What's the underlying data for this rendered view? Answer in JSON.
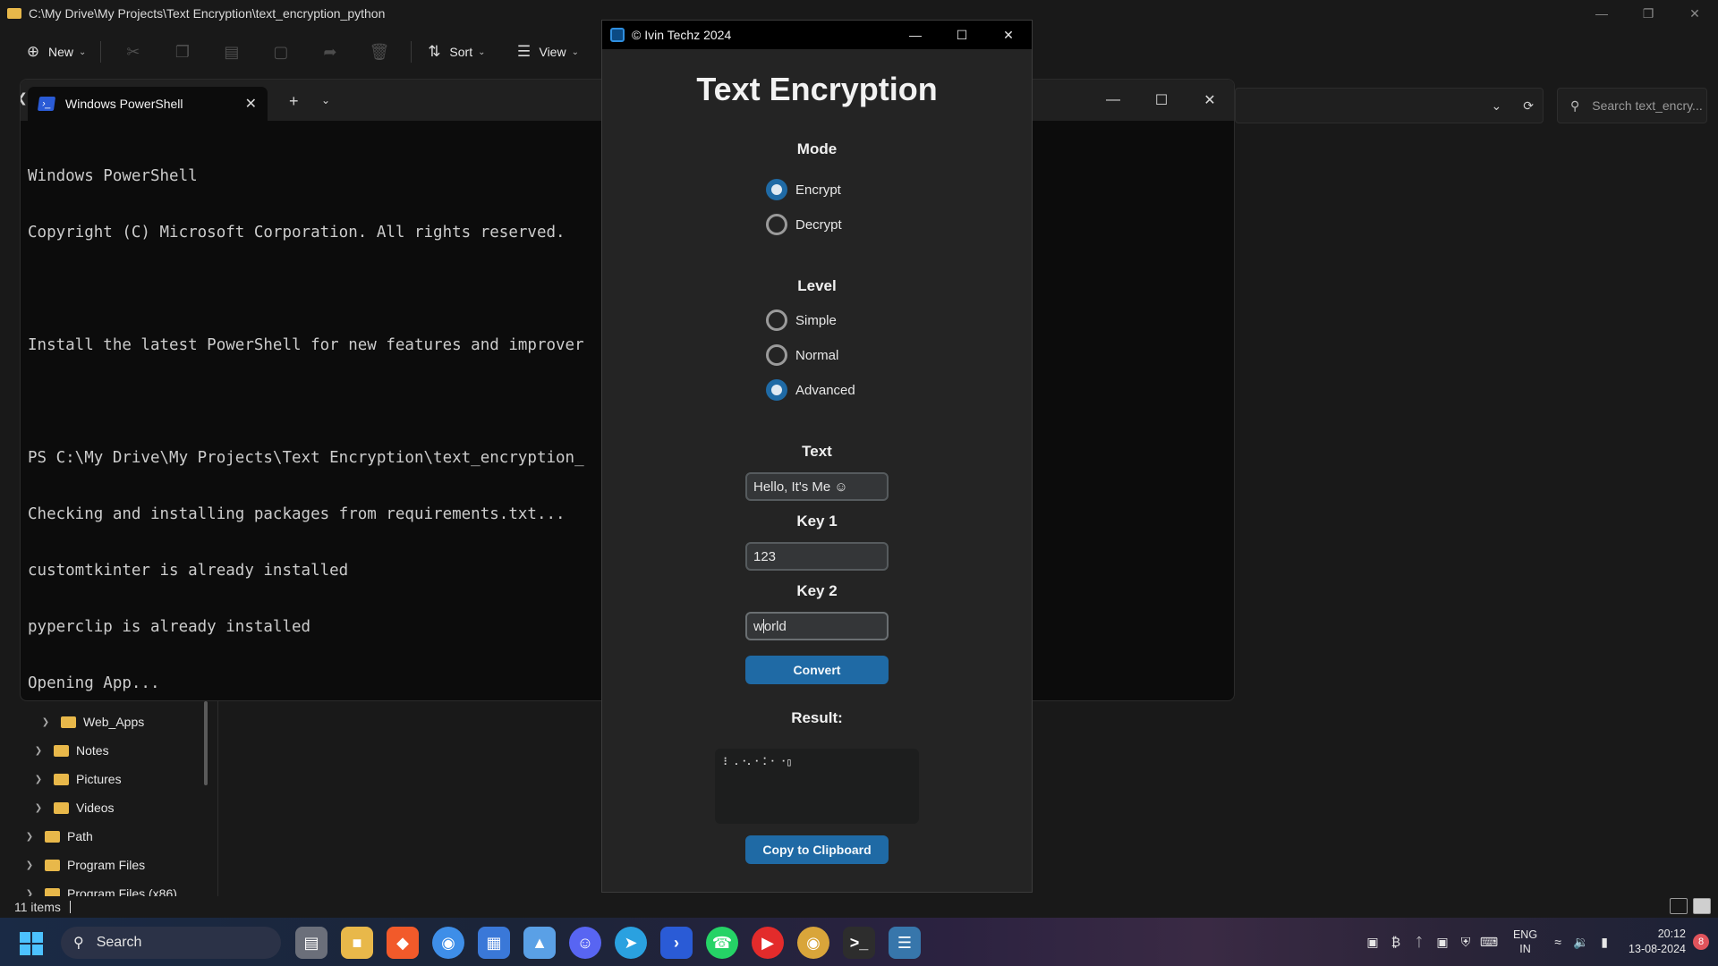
{
  "explorer": {
    "path": "C:\\My Drive\\My Projects\\Text Encryption\\text_encryption_python",
    "toolbar": {
      "new_label": "New",
      "sort_label": "Sort",
      "view_label": "View"
    },
    "search_placeholder": "Search text_encry...",
    "nav_items": [
      {
        "label": "Web_Apps"
      },
      {
        "label": "Notes"
      },
      {
        "label": "Pictures"
      },
      {
        "label": "Videos"
      },
      {
        "label": "Path"
      },
      {
        "label": "Program Files"
      },
      {
        "label": "Program Files (x86)"
      }
    ],
    "status": "11 items"
  },
  "terminal": {
    "tab_title": "Windows PowerShell",
    "lines": [
      "Windows PowerShell",
      "Copyright (C) Microsoft Corporation. All rights reserved.",
      "",
      "Install the latest PowerShell for new features and improver",
      "",
      "PS C:\\My Drive\\My Projects\\Text Encryption\\text_encryption_",
      "Checking and installing packages from requirements.txt...",
      "customtkinter is already installed",
      "pyperclip is already installed",
      "Opening App..."
    ]
  },
  "app": {
    "window_title": "© Ivin Techz 2024",
    "heading": "Text Encryption",
    "mode": {
      "label": "Mode",
      "options": [
        {
          "label": "Encrypt",
          "checked": true
        },
        {
          "label": "Decrypt",
          "checked": false
        }
      ]
    },
    "level": {
      "label": "Level",
      "options": [
        {
          "label": "Simple",
          "checked": false
        },
        {
          "label": "Normal",
          "checked": false
        },
        {
          "label": "Advanced",
          "checked": true
        }
      ]
    },
    "text": {
      "label": "Text",
      "value": "Hello, It's Me ☺"
    },
    "key1": {
      "label": "Key 1",
      "value": "123"
    },
    "key2": {
      "label": "Key 2",
      "value_before_cursor": "w",
      "value_after_cursor": "orld"
    },
    "convert_label": "Convert",
    "result": {
      "label": "Result:",
      "value": "⠇⠠⠐⠄⠂⠅⠂⠐▯"
    },
    "copy_label": "Copy to Clipboard",
    "accent_color": "#1f6aa5"
  },
  "taskbar": {
    "search_label": "Search",
    "lang_line1": "ENG",
    "lang_line2": "IN",
    "time": "20:12",
    "date": "13-08-2024",
    "notification_count": "8",
    "apps": [
      "file-explorer-task-icon",
      "files-icon",
      "brave-icon",
      "chrome-icon",
      "store-icon",
      "photos-icon",
      "discord-icon",
      "telegram-icon",
      "powershell-icon",
      "whatsapp-icon",
      "youtube-icon",
      "chrome-profile-icon",
      "terminal-icon",
      "python-icon"
    ]
  }
}
